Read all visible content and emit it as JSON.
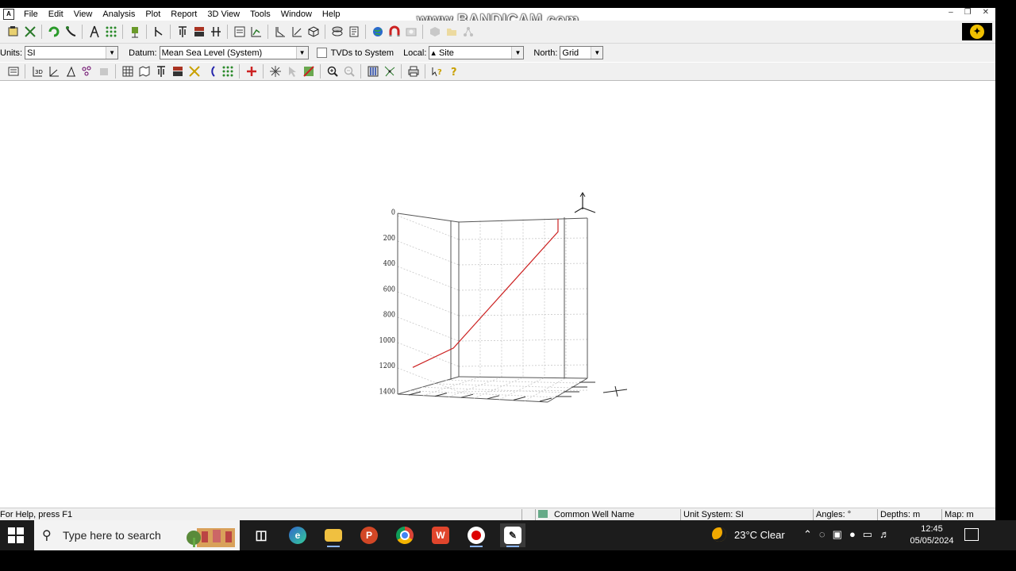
{
  "menubar": {
    "app_icon": "A",
    "items": [
      "File",
      "Edit",
      "View",
      "Analysis",
      "Plot",
      "Report",
      "3D View",
      "Tools",
      "Window",
      "Help"
    ]
  },
  "watermark": "www.BANDICAM.com",
  "toolbar2": {
    "units_label": "Units:",
    "units_value": "SI",
    "datum_label": "Datum:",
    "datum_value": "Mean Sea Level (System)",
    "tvd_label": "TVDs to System",
    "local_label": "Local:",
    "local_value": "Site",
    "north_label": "North:",
    "north_value": "Grid"
  },
  "chart_data": {
    "type": "line",
    "title": "",
    "ylabel": "",
    "y_ticks": [
      "0",
      "200",
      "400",
      "600",
      "800",
      "1000",
      "1200",
      "1400"
    ],
    "ylim": [
      0,
      1400
    ],
    "grid": true,
    "series": [
      {
        "color": "#cc2222",
        "points_tvd": [
          0,
          100,
          1000,
          1150
        ],
        "description_values": "well trajectory: vertical then build then near-horizontal"
      }
    ]
  },
  "statusbar": {
    "help": "For Help, press F1",
    "well_name": "Common Well Name",
    "unit_system": "Unit System: SI",
    "angles": "Angles: °",
    "depths": "Depths: m",
    "map": "Map: m"
  },
  "taskbar": {
    "search_placeholder": "Type here to search",
    "weather": "23°C  Clear",
    "time": "12:45",
    "date": "05/05/2024"
  },
  "colors": {
    "accent": "#cc2222",
    "taskbar": "#1c1c1c",
    "toolbar": "#f0f0f0"
  }
}
